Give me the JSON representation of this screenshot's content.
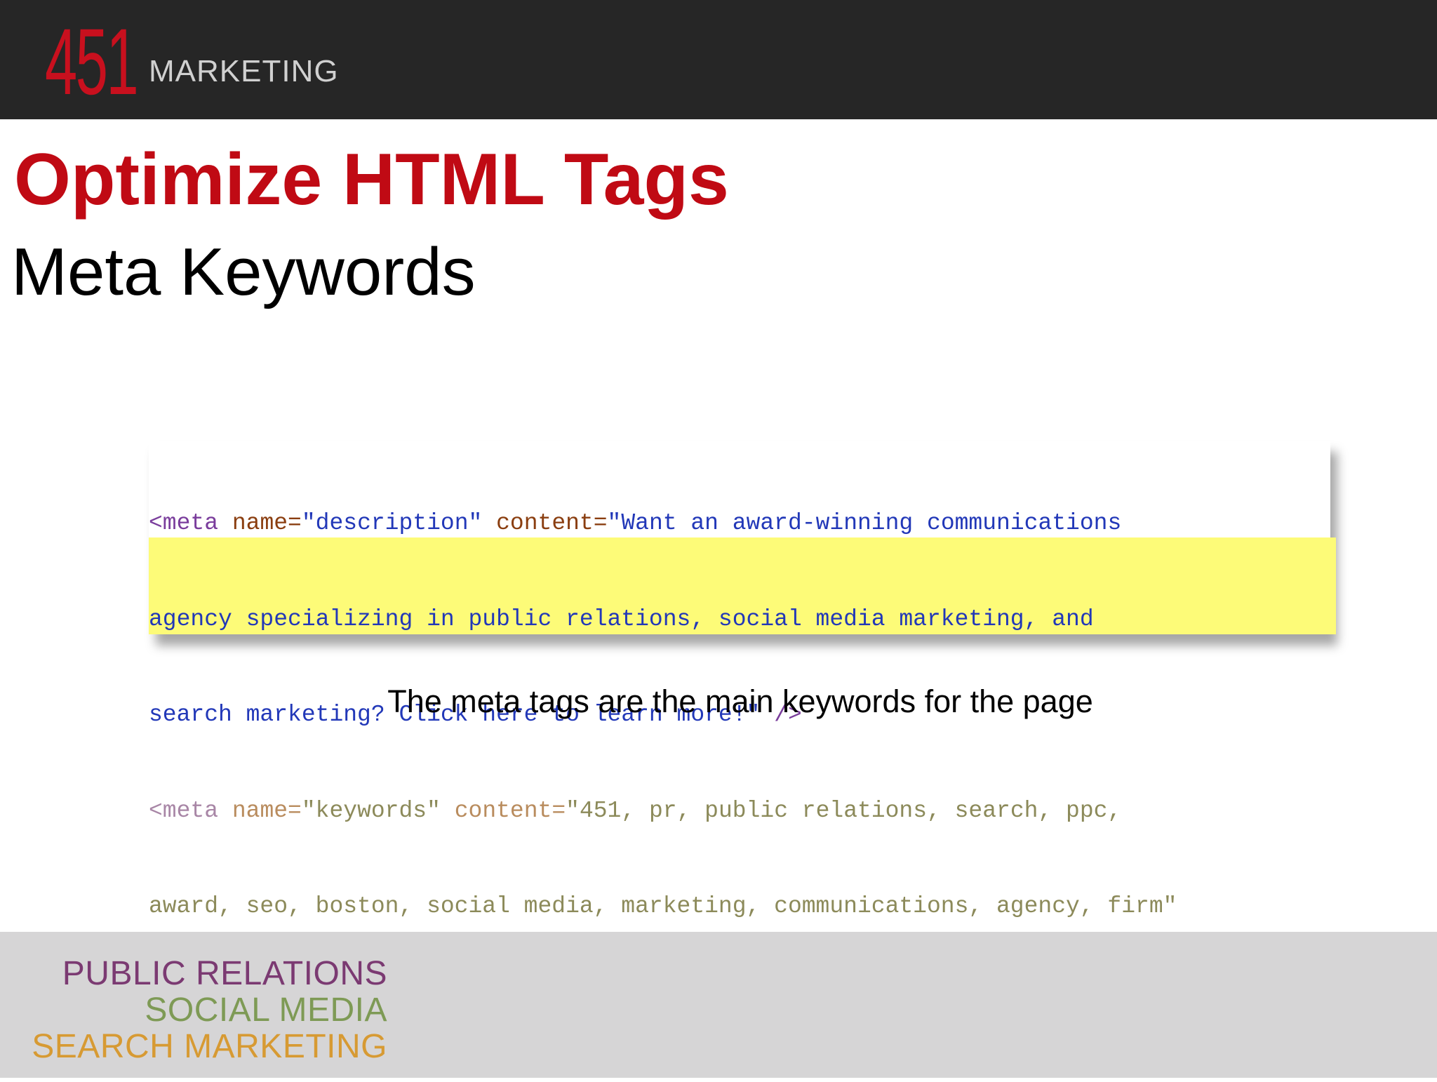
{
  "header": {
    "logo_number": "451",
    "logo_word": "MARKETING"
  },
  "slide": {
    "title": "Optimize HTML Tags",
    "subtitle": "Meta Keywords",
    "caption": "The meta tags are the main keywords for the page"
  },
  "code": {
    "line1": {
      "tag": "<meta",
      "attr1": " name=",
      "val1": "\"description\"",
      "attr2": " content=",
      "val2": "\"Want an award-winning communications"
    },
    "line2": "agency specializing in public relations, social media marketing, and",
    "line3": {
      "text": "search marketing? Click here to learn more!\"",
      "end": " />"
    },
    "line4": {
      "tag": "<meta",
      "attr1": " name=",
      "val1": "\"keywords\"",
      "attr2": " content=",
      "val2": "\"451, pr, public relations, search, ppc,"
    },
    "line5": "award, seo, boston, social media, marketing, communications, agency, firm\"",
    "line6": "/>"
  },
  "footer": {
    "line1": "PUBLIC RELATIONS",
    "line2": "SOCIAL MEDIA",
    "line3": "SEARCH MARKETING"
  },
  "colors": {
    "brand_red": "#c00a14",
    "header_bg": "#262626",
    "highlight": "#fdfb78",
    "footer_bg": "#d6d5d6"
  }
}
